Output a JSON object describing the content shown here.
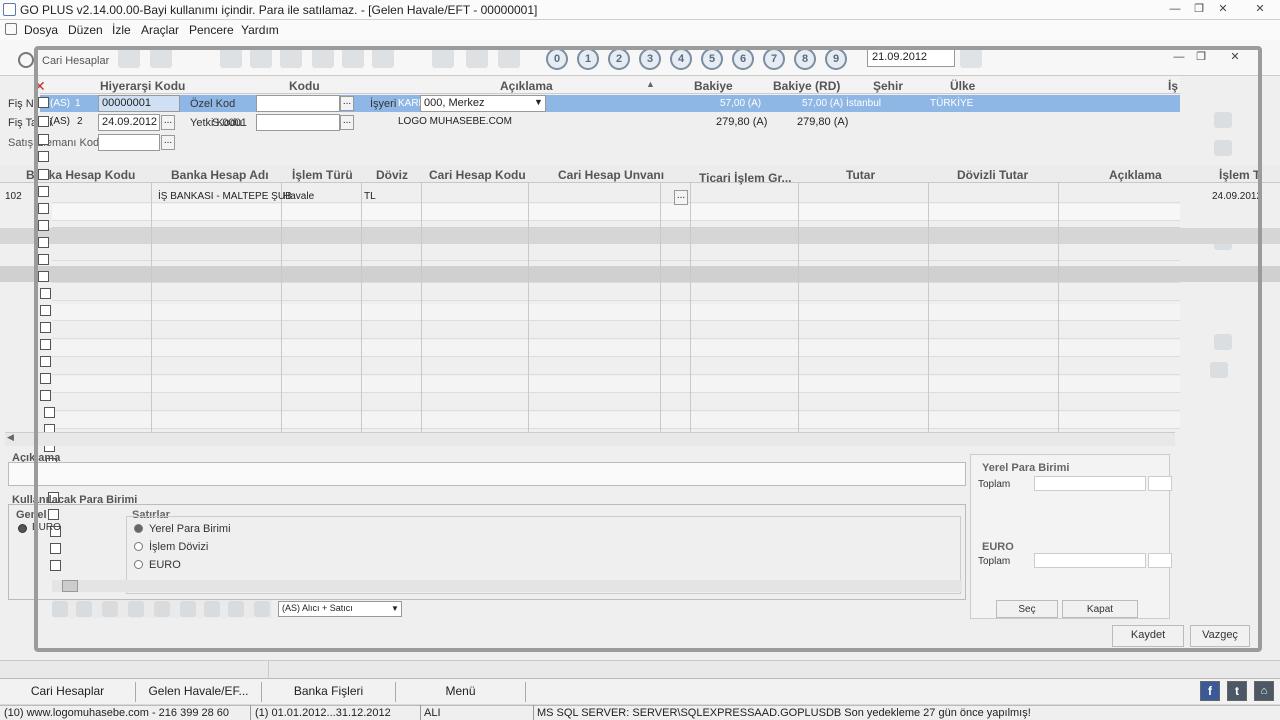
{
  "window": {
    "title": "GO PLUS v2.14.00.00-Bayi kullanımı içindir. Para ile satılamaz. - [Gelen Havale/EFT - 00000001]"
  },
  "menu": [
    "Dosya",
    "Düzen",
    "İzle",
    "Araçlar",
    "Pencere",
    "Yardım"
  ],
  "toolbar": {
    "date": "21.09.2012",
    "circles": [
      "0",
      "1",
      "2",
      "3",
      "4",
      "5",
      "6",
      "7",
      "8",
      "9"
    ]
  },
  "cari_window": {
    "title": "Cari Hesaplar"
  },
  "cari_grid": {
    "columns": [
      "Hiyerarşi Kodu",
      "Kodu",
      "Açıklama",
      "Bakiye",
      "Bakiye (RD)",
      "Şehir",
      "Ülke",
      "İş"
    ],
    "rows": [
      {
        "no": "(AS)",
        "num": "1",
        "kod": "00000001",
        "aciklama": "KARE...LİM LTD.ŞTİ.",
        "bakiye": "57,00 (A)",
        "bakiye_rd": "57,00 (A)",
        "sehir": "İstanbul",
        "ulke": "TÜRKİYE"
      },
      {
        "no": "(AS)",
        "num": "2",
        "kod": "24.09.2012",
        "aciklama": "LOGO MUHASEBE.COM",
        "bakiye": "279,80 (A)",
        "bakiye_rd": "279,80 (A)",
        "sehir": "",
        "ulke": ""
      }
    ]
  },
  "form": {
    "fis_no_label": "Fiş No",
    "fis_tarihi_label": "Fiş Tarihi",
    "satis_elemani_label": "Satış Elemanı Kodu",
    "ozel_kod_label": "Özel Kod",
    "yetki_kodu_label": "Yetki Kodu",
    "yetki_kodu_value": "S.0001",
    "isyeri_label": "İşyeri",
    "isyeri_value": "000, Merkez"
  },
  "lines_grid": {
    "columns": [
      "Banka Hesap Kodu",
      "Banka Hesap Adı",
      "İşlem Türü",
      "Döviz",
      "Cari Hesap Kodu",
      "Cari Hesap Unvanı",
      "Ticari İşlem Gr...",
      "Tutar",
      "Dövizli Tutar",
      "Açıklama",
      "İşlem T"
    ],
    "row": {
      "no": "102",
      "banka_adi": "İŞ BANKASI - MALTEPE ŞUB",
      "islem_turu": "Havale",
      "doviz": "TL",
      "islem_tarihi": "24.09.2012"
    }
  },
  "bottom": {
    "aciklama_label": "Açıklama",
    "para_birimi_title": "Kullanılacak Para Birimi",
    "genel_label": "Genel",
    "genel_value": "EURO",
    "satirlar_label": "Satırlar",
    "options": [
      "Yerel Para Birimi",
      "İşlem Dövizi",
      "EURO"
    ],
    "yerel_title": "Yerel Para Birimi",
    "toplam_label": "Toplam",
    "euro_title": "EURO",
    "sec_button": "Seç",
    "kapat_button": "Kapat",
    "kaydet_button": "Kaydet",
    "vazgec_button": "Vazgeç",
    "filter_select": "(AS) Alıcı + Satıcı"
  },
  "taskbar": [
    "Cari Hesaplar",
    "Gelen Havale/EF...",
    "Banka Fişleri",
    "Menü"
  ],
  "status": {
    "site": "(10) www.logomuhasebe.com - 216 399 28 60",
    "period": "(1) 01.01.2012...31.12.2012",
    "mode": "ALI",
    "server": "MS SQL SERVER: SERVER\\SQLEXPRESSAAD.GOPLUSDB Son yedekleme 27 gün önce yapılmış!"
  },
  "social_icons": [
    "facebook-icon",
    "twitter-icon",
    "home-icon"
  ]
}
